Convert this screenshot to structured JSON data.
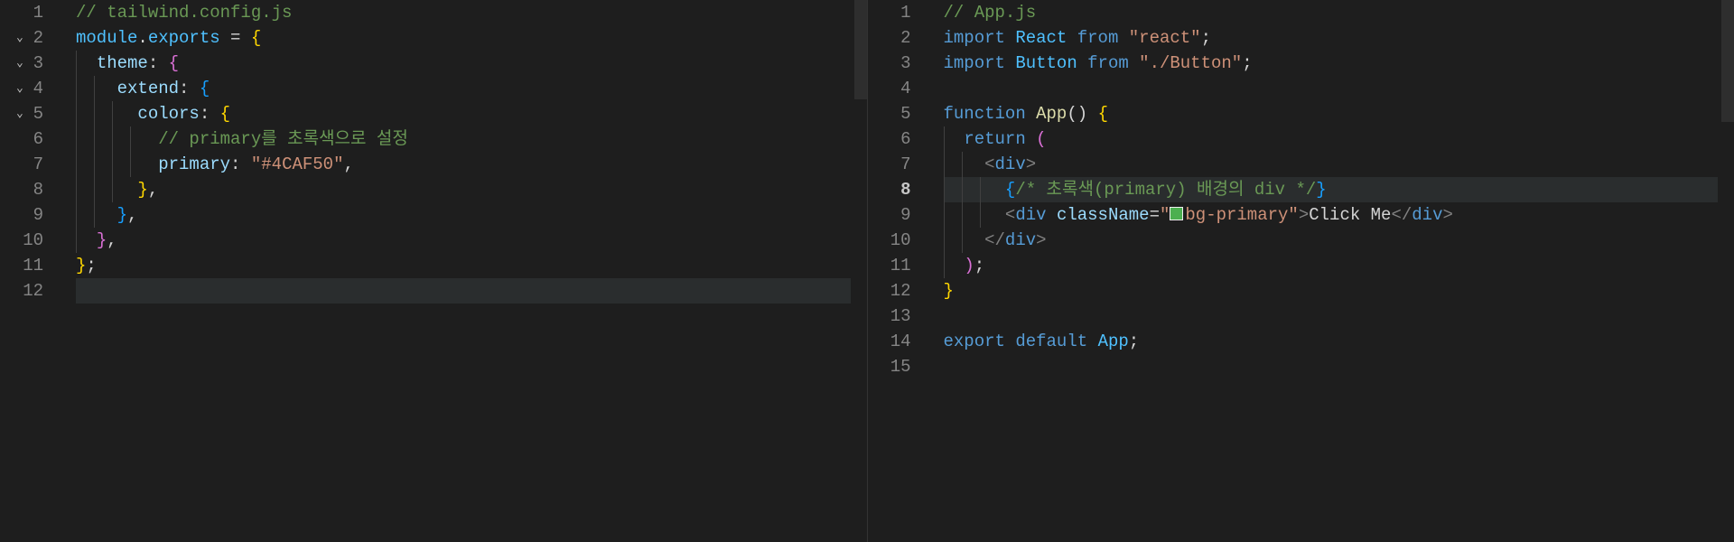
{
  "left": {
    "lines": [
      {
        "n": "1"
      },
      {
        "n": "2",
        "fold": true
      },
      {
        "n": "3",
        "fold": true
      },
      {
        "n": "4",
        "fold": true
      },
      {
        "n": "5",
        "fold": true
      },
      {
        "n": "6"
      },
      {
        "n": "7"
      },
      {
        "n": "8"
      },
      {
        "n": "9"
      },
      {
        "n": "10"
      },
      {
        "n": "11"
      },
      {
        "n": "12"
      }
    ],
    "tokens": {
      "l1_c1": "// tailwind.config.js",
      "l2_t1": "module",
      "l2_t2": ".",
      "l2_t3": "exports",
      "l2_t4": " = ",
      "l2_t5": "{",
      "l3_t1": "  ",
      "l3_t2": "theme",
      "l3_t3": ": ",
      "l3_t4": "{",
      "l4_t1": "    ",
      "l4_t2": "extend",
      "l4_t3": ": ",
      "l4_t4": "{",
      "l5_t1": "      ",
      "l5_t2": "colors",
      "l5_t3": ": ",
      "l5_t4": "{",
      "l6_t1": "        ",
      "l6_t2": "// primary를 초록색으로 설정",
      "l7_t1": "        ",
      "l7_t2": "primary",
      "l7_t3": ": ",
      "l7_t4": "\"#4CAF50\"",
      "l7_t5": ",",
      "l8_t1": "      ",
      "l8_t2": "}",
      "l8_t3": ",",
      "l9_t1": "    ",
      "l9_t2": "}",
      "l9_t3": ",",
      "l10_t1": "  ",
      "l10_t2": "}",
      "l10_t3": ",",
      "l11_t1": "}",
      "l11_t2": ";"
    }
  },
  "right": {
    "lines": [
      {
        "n": "1"
      },
      {
        "n": "2"
      },
      {
        "n": "3"
      },
      {
        "n": "4"
      },
      {
        "n": "5"
      },
      {
        "n": "6"
      },
      {
        "n": "7"
      },
      {
        "n": "8",
        "active": true
      },
      {
        "n": "9"
      },
      {
        "n": "10"
      },
      {
        "n": "11"
      },
      {
        "n": "12"
      },
      {
        "n": "13"
      },
      {
        "n": "14"
      },
      {
        "n": "15"
      }
    ],
    "tokens": {
      "l1_c1": "// App.js",
      "l2_t1": "import",
      "l2_t2": " ",
      "l2_t3": "React",
      "l2_t4": " ",
      "l2_t5": "from",
      "l2_t6": " ",
      "l2_t7": "\"react\"",
      "l2_t8": ";",
      "l3_t1": "import",
      "l3_t2": " ",
      "l3_t3": "Button",
      "l3_t4": " ",
      "l3_t5": "from",
      "l3_t6": " ",
      "l3_t7": "\"./Button\"",
      "l3_t8": ";",
      "l5_t1": "function",
      "l5_t2": " ",
      "l5_t3": "App",
      "l5_t4": "() ",
      "l5_t5": "{",
      "l6_t1": "  ",
      "l6_t2": "return",
      "l6_t3": " ",
      "l6_t4": "(",
      "l7_t1": "    ",
      "l7_t2": "<",
      "l7_t3": "div",
      "l7_t4": ">",
      "l8_t1": "      ",
      "l8_t2": "{",
      "l8_t3": "/* 초록색(primary) 배경의 div */",
      "l8_t4": "}",
      "l9_t1": "      ",
      "l9_t2": "<",
      "l9_t3": "div",
      "l9_t4": " ",
      "l9_t5": "className",
      "l9_t6": "=",
      "l9_t7": "\"",
      "l9_t8": "bg-primary",
      "l9_t9": "\"",
      "l9_t10": ">",
      "l9_t11": "Click Me",
      "l9_t12": "</",
      "l9_t13": "div",
      "l9_t14": ">",
      "l10_t1": "    ",
      "l10_t2": "</",
      "l10_t3": "div",
      "l10_t4": ">",
      "l11_t1": "  ",
      "l11_t2": ")",
      "l11_t3": ";",
      "l12_t1": "}",
      "l14_t1": "export",
      "l14_t2": " ",
      "l14_t3": "default",
      "l14_t4": " ",
      "l14_t5": "App",
      "l14_t6": ";"
    }
  }
}
